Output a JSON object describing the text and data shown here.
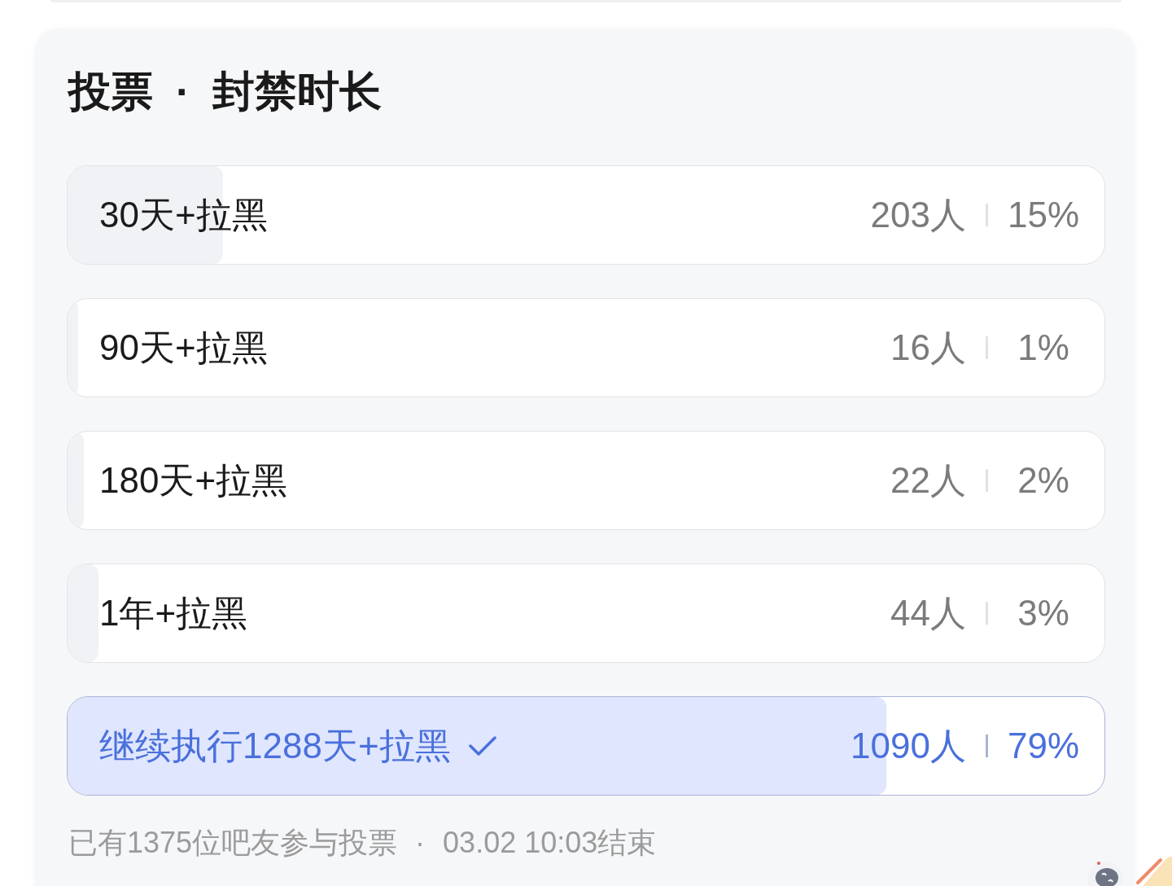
{
  "title": {
    "label": "投票",
    "separator": "·",
    "topic": "封禁时长"
  },
  "options": [
    {
      "label": "30天+拉黑",
      "count": "203人",
      "percent": "15%",
      "level": 0.15,
      "selected": false
    },
    {
      "label": "90天+拉黑",
      "count": "16人",
      "percent": "1%",
      "level": 0.01,
      "selected": false
    },
    {
      "label": "180天+拉黑",
      "count": "22人",
      "percent": "2%",
      "level": 0.016,
      "selected": false
    },
    {
      "label": "1年+拉黑",
      "count": "44人",
      "percent": "3%",
      "level": 0.03,
      "selected": false
    },
    {
      "label": "继续执行1288天+拉黑",
      "count": "1090人",
      "percent": "79%",
      "level": 0.79,
      "selected": true
    }
  ],
  "footer": {
    "participants": "已有1375位吧友参与投票",
    "separator": "·",
    "end_time": "03.02 10:03结束"
  }
}
